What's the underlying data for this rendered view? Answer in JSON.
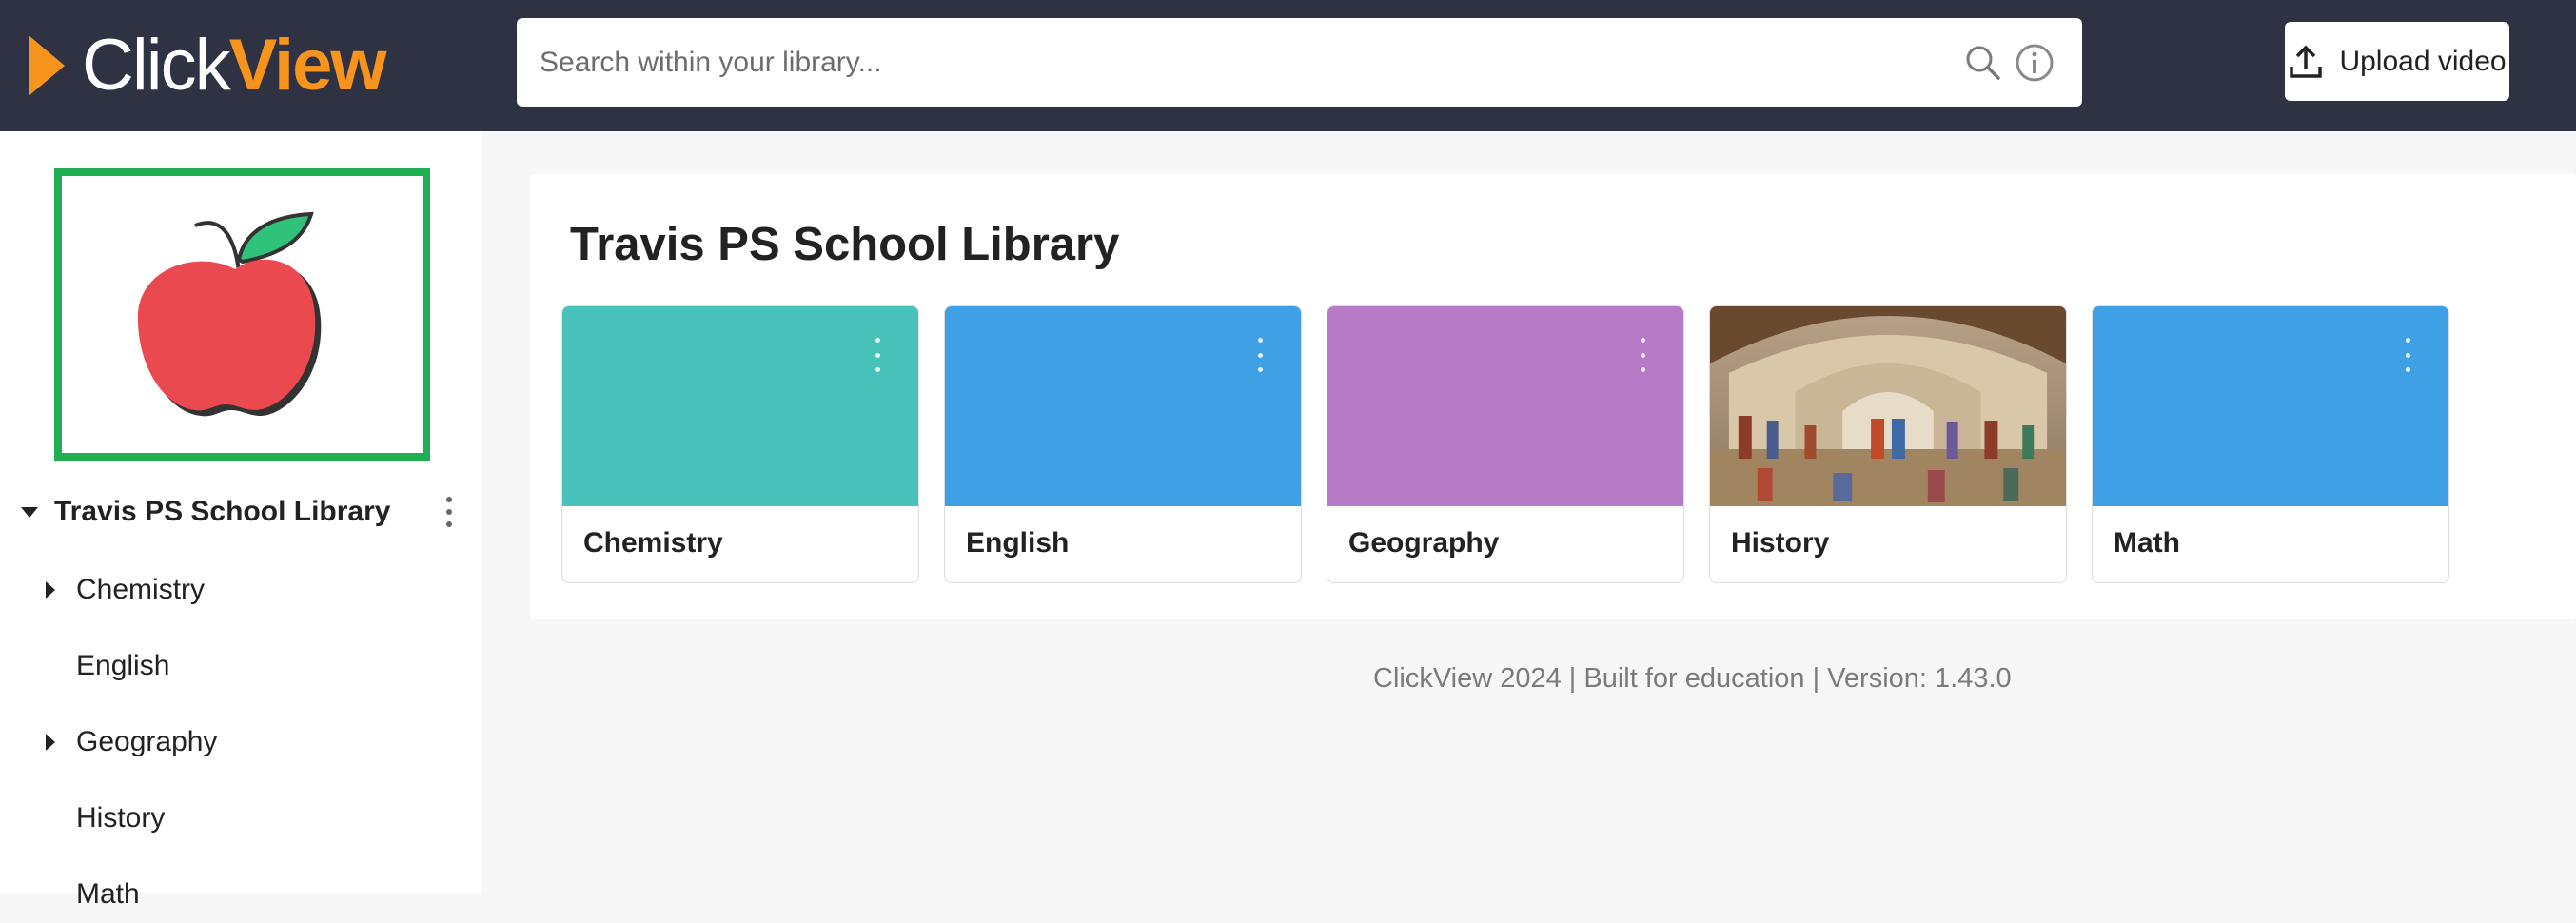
{
  "header": {
    "logo_part1": "Click",
    "logo_part2": "View",
    "search_placeholder": "Search within your library...",
    "upload_label": "Upload video"
  },
  "colors": {
    "header_bg": "#2f3242",
    "brand_orange": "#f7941d",
    "logo_frame": "#1fae51"
  },
  "sidebar": {
    "logo_icon": "apple-icon",
    "root_label": "Travis PS School Library",
    "items": [
      {
        "label": "Chemistry",
        "expandable": true
      },
      {
        "label": "English",
        "expandable": false
      },
      {
        "label": "Geography",
        "expandable": true
      },
      {
        "label": "History",
        "expandable": false
      },
      {
        "label": "Math",
        "expandable": false
      }
    ]
  },
  "main": {
    "title": "Travis PS School Library",
    "cards": [
      {
        "label": "Chemistry",
        "color": "#48c2bb"
      },
      {
        "label": "English",
        "color": "#3fa0e6"
      },
      {
        "label": "Geography",
        "color": "#b67ac7"
      },
      {
        "label": "History",
        "color": "image"
      },
      {
        "label": "Math",
        "color": "#3fa0e6"
      }
    ]
  },
  "footer": {
    "text": "ClickView 2024 | Built for education | Version: 1.43.0"
  }
}
